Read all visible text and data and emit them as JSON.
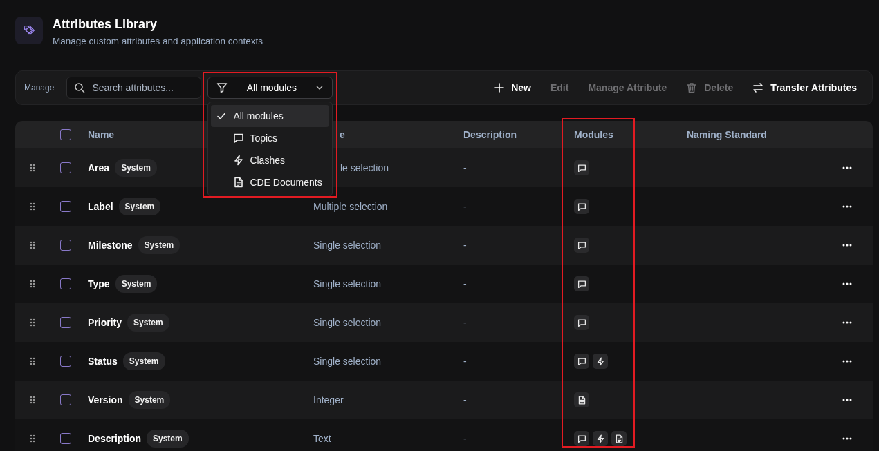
{
  "header": {
    "title": "Attributes Library",
    "subtitle": "Manage custom attributes and application contexts"
  },
  "toolbar": {
    "label": "Manage",
    "search": {
      "placeholder": "Search attributes..."
    },
    "filter": {
      "value": "All modules",
      "expanded": true,
      "options": [
        {
          "label": "All modules",
          "kind": "all",
          "selected": true
        },
        {
          "label": "Topics",
          "kind": "topics",
          "selected": false
        },
        {
          "label": "Clashes",
          "kind": "clashes",
          "selected": false
        },
        {
          "label": "CDE Documents",
          "kind": "documents",
          "selected": false
        }
      ]
    },
    "actions": [
      {
        "label": "New",
        "kind": "new",
        "disabled": false
      },
      {
        "label": "Edit",
        "kind": "edit",
        "disabled": true
      },
      {
        "label": "Manage Attribute",
        "kind": "manage",
        "disabled": true
      },
      {
        "label": "Delete",
        "kind": "delete",
        "disabled": true
      },
      {
        "label": "Transfer Attributes",
        "kind": "transfer",
        "disabled": false
      }
    ]
  },
  "table": {
    "select_all": {
      "checked": false
    },
    "columns": [
      "Name",
      "e",
      "Description",
      "Modules",
      "Naming Standard"
    ],
    "rows": [
      {
        "name": "Area",
        "badge": "System",
        "type": "le selection",
        "description": "-",
        "modules": [
          {
            "kind": "topics"
          }
        ],
        "checked": false
      },
      {
        "name": "Label",
        "badge": "System",
        "type": "Multiple selection",
        "description": "-",
        "modules": [
          {
            "kind": "topics"
          }
        ],
        "checked": false
      },
      {
        "name": "Milestone",
        "badge": "System",
        "type": "Single selection",
        "description": "-",
        "modules": [
          {
            "kind": "topics"
          }
        ],
        "checked": false
      },
      {
        "name": "Type",
        "badge": "System",
        "type": "Single selection",
        "description": "-",
        "modules": [
          {
            "kind": "topics"
          }
        ],
        "checked": false
      },
      {
        "name": "Priority",
        "badge": "System",
        "type": "Single selection",
        "description": "-",
        "modules": [
          {
            "kind": "topics"
          }
        ],
        "checked": false
      },
      {
        "name": "Status",
        "badge": "System",
        "type": "Single selection",
        "description": "-",
        "modules": [
          {
            "kind": "topics"
          },
          {
            "kind": "clashes"
          }
        ],
        "checked": false
      },
      {
        "name": "Version",
        "badge": "System",
        "type": "Integer",
        "description": "-",
        "modules": [
          {
            "kind": "documents"
          }
        ],
        "checked": false
      },
      {
        "name": "Description",
        "badge": "System",
        "type": "Text",
        "description": "-",
        "modules": [
          {
            "kind": "topics"
          },
          {
            "kind": "clashes"
          },
          {
            "kind": "documents"
          }
        ],
        "checked": false
      }
    ]
  },
  "highlights": {
    "filter": true,
    "modules_column": true
  }
}
